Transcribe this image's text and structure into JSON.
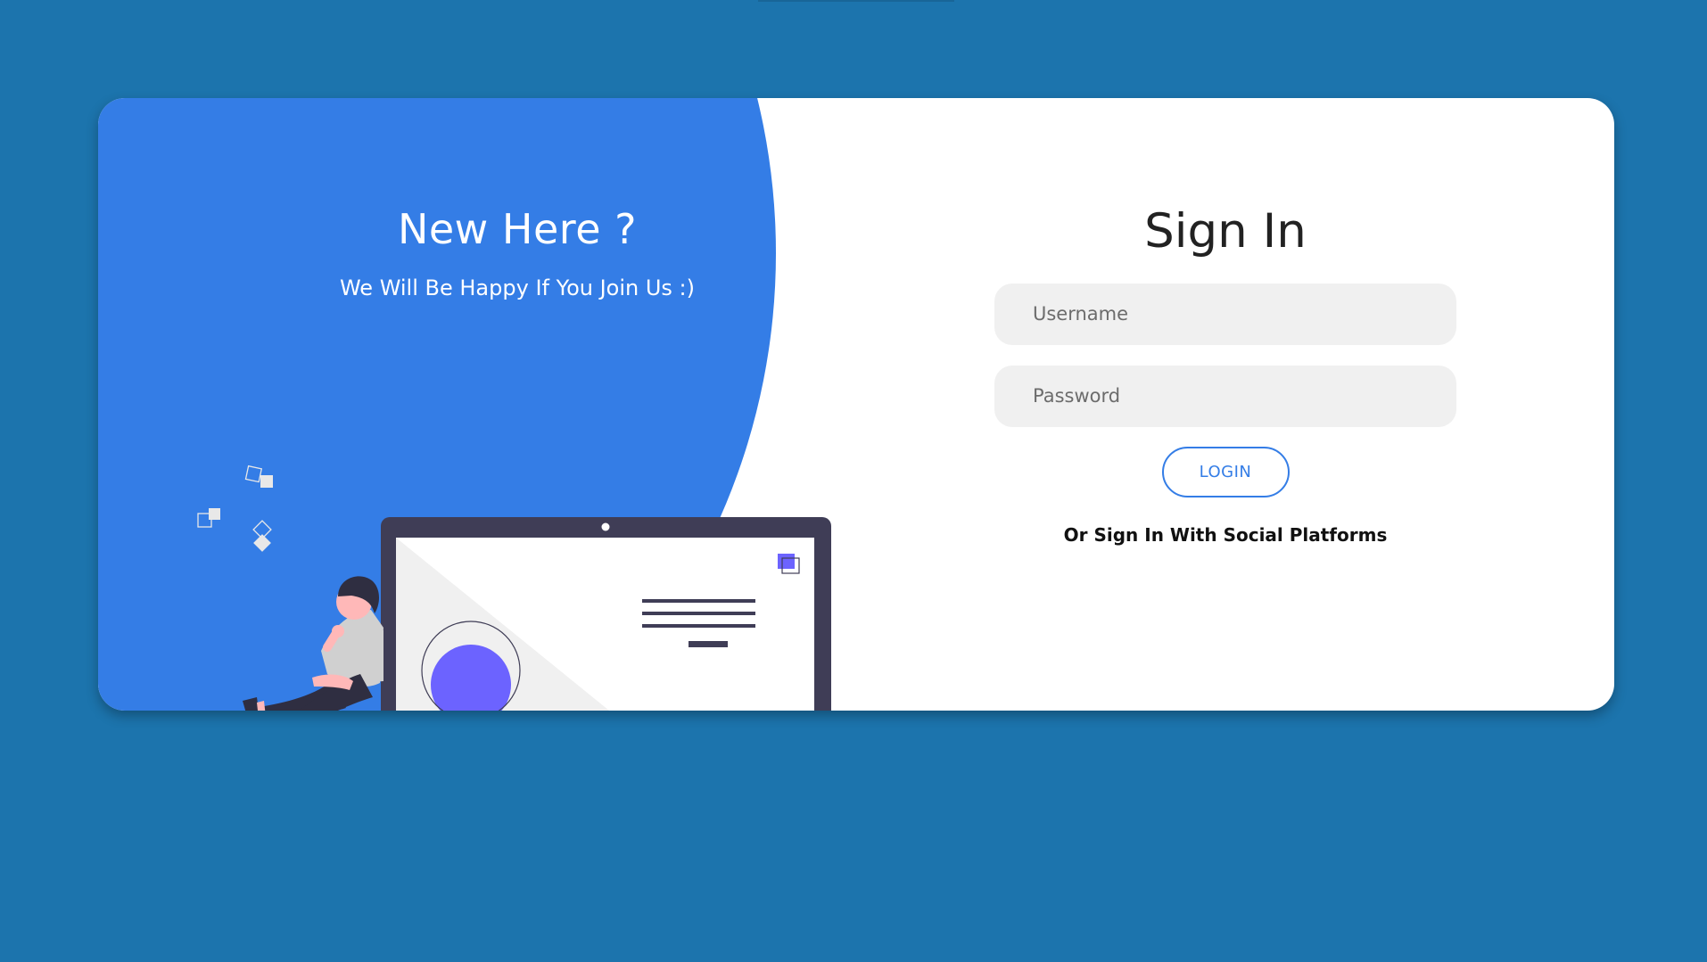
{
  "panel": {
    "title": "New Here ?",
    "subtitle": "We Will Be Happy If You Join Us :)"
  },
  "signin": {
    "title": "Sign In",
    "username_placeholder": "Username",
    "password_placeholder": "Password",
    "login_label": "LOGIN",
    "social_text": "Or Sign In With Social Platforms"
  },
  "colors": {
    "page_background": "#1c74ad",
    "panel_blue": "#347de6",
    "card_background": "#ffffff",
    "input_background": "#f0f0f0",
    "laptop_frame": "#3f3d56",
    "accent_purple": "#6c63ff"
  },
  "icons": {
    "illustration": "person-leaning-on-laptop"
  }
}
